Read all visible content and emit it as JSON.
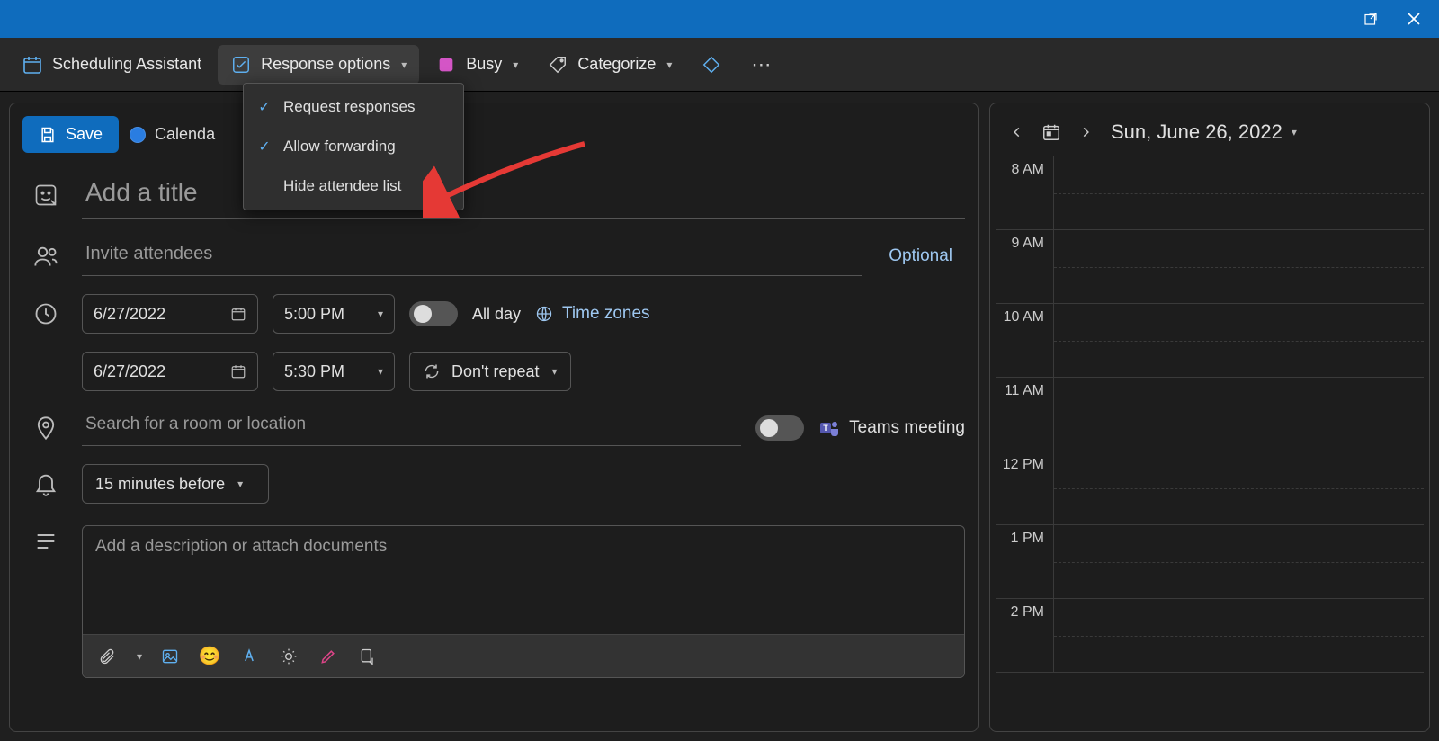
{
  "toolbar": {
    "scheduling_assistant": "Scheduling Assistant",
    "response_options": "Response options",
    "busy": "Busy",
    "categorize": "Categorize"
  },
  "dropdown": {
    "request_responses": "Request responses",
    "allow_forwarding": "Allow forwarding",
    "hide_attendee": "Hide attendee list"
  },
  "left": {
    "save": "Save",
    "calendar_label": "Calenda",
    "title_placeholder": "Add a title",
    "attendees_placeholder": "Invite attendees",
    "optional": "Optional",
    "start_date": "6/27/2022",
    "start_time": "5:00 PM",
    "end_date": "6/27/2022",
    "end_time": "5:30 PM",
    "all_day": "All day",
    "time_zones": "Time zones",
    "repeat": "Don't repeat",
    "location_placeholder": "Search for a room or location",
    "teams_meeting": "Teams meeting",
    "reminder": "15 minutes before",
    "description_placeholder": "Add a description or attach documents"
  },
  "right": {
    "date_label": "Sun, June 26, 2022",
    "hours": [
      "8 AM",
      "9 AM",
      "10 AM",
      "11 AM",
      "12 PM",
      "1 PM",
      "2 PM"
    ]
  }
}
